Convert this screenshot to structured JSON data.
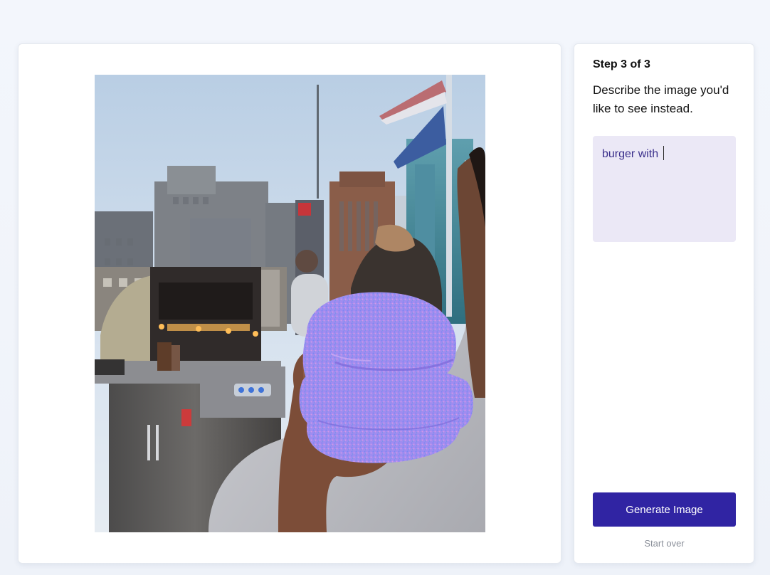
{
  "wizard": {
    "step_label": "Step 3 of 3",
    "instruction": "Describe the image you'd like to see instead.",
    "prompt_value": "burger with "
  },
  "actions": {
    "generate_label": "Generate Image",
    "start_over_label": "Start over"
  },
  "photo": {
    "description_icon": "edited-photo-with-masked-burger"
  },
  "colors": {
    "primary_button": "#3024a3",
    "prompt_background": "#ebe8f6",
    "prompt_text": "#3a2f8b",
    "mask_overlay": "#a08cf0"
  }
}
